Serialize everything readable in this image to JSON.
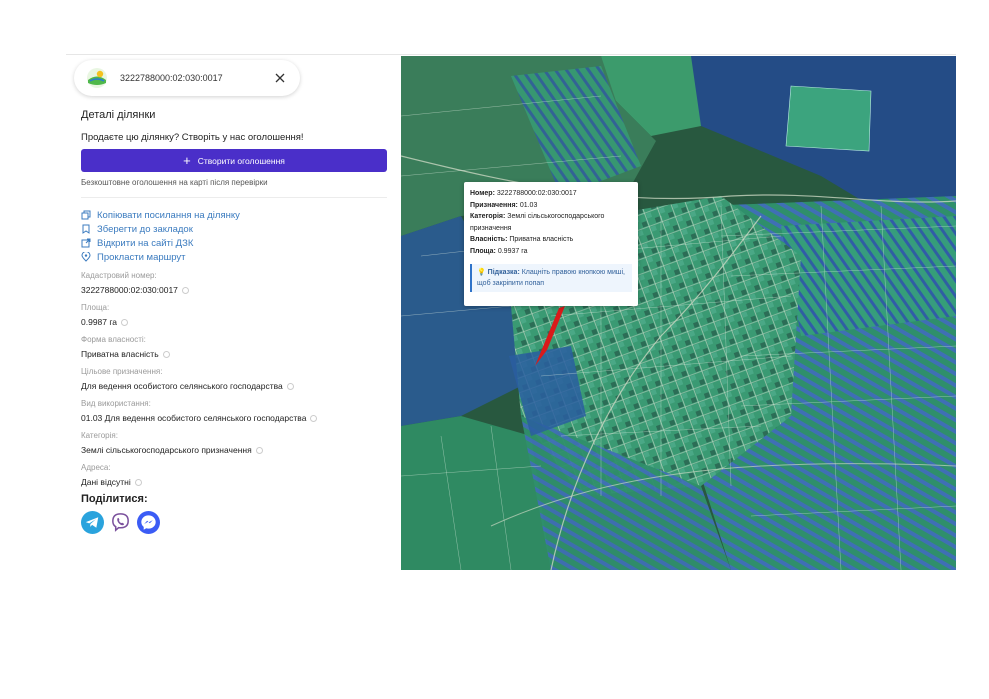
{
  "search": {
    "value": "3222788000:02:030:0017"
  },
  "panel": {
    "title": "Деталі ділянки",
    "sell_prompt": "Продаєте цю ділянку? Створіть у нас оголошення!",
    "create_button": "Створити оголошення",
    "free_note": "Безкоштовне оголошення на карті після перевірки"
  },
  "actions": [
    {
      "label": "Копіювати посилання на ділянку",
      "icon": "copy-icon"
    },
    {
      "label": "Зберегти до закладок",
      "icon": "bookmark-icon"
    },
    {
      "label": "Відкрити на сайті ДЗК",
      "icon": "external-link-icon"
    },
    {
      "label": "Прокласти маршрут",
      "icon": "location-pin-icon"
    }
  ],
  "fields": [
    {
      "label": "Кадастровий номер:",
      "value": "3222788000:02:030:0017"
    },
    {
      "label": "Площа:",
      "value": "0.9987 га"
    },
    {
      "label": "Форма власності:",
      "value": "Приватна власність"
    },
    {
      "label": "Цільове призначення:",
      "value": "Для ведення особистого селянського господарства"
    },
    {
      "label": "Вид використання:",
      "value": "01.03 Для ведення особистого селянського господарства"
    },
    {
      "label": "Категорія:",
      "value": "Землі сільськогосподарського призначення"
    },
    {
      "label": "Адреса:",
      "value": "Дані відсутні"
    }
  ],
  "share": {
    "title": "Поділитися:",
    "buttons": [
      {
        "name": "telegram",
        "icon": "telegram-icon",
        "color": "#2aa3dd"
      },
      {
        "name": "viber",
        "icon": "viber-icon",
        "color": "#7b519d"
      },
      {
        "name": "messenger",
        "icon": "messenger-icon",
        "color": "#3b5cf5"
      }
    ]
  },
  "popup": {
    "number_label": "Номер:",
    "number_value": "3222788000:02:030:0017",
    "purpose_label": "Призначення:",
    "purpose_value": "01.03",
    "category_label": "Категорія:",
    "category_value": "Землі сільськогосподарського призначення",
    "ownership_label": "Власність:",
    "ownership_value": "Приватна власність",
    "area_label": "Площа:",
    "area_value": "0.9937 га",
    "hint_label": "Підказка:",
    "hint_text": "Клацніть правою кнопкою миші, щоб закріпити попап"
  },
  "colors": {
    "accent": "#4a2fc9",
    "link": "#3b7bbf",
    "parcel_selected": "#d91a1a",
    "parcel_green": "#3fae7e",
    "parcel_blue": "#2d5aa8"
  }
}
